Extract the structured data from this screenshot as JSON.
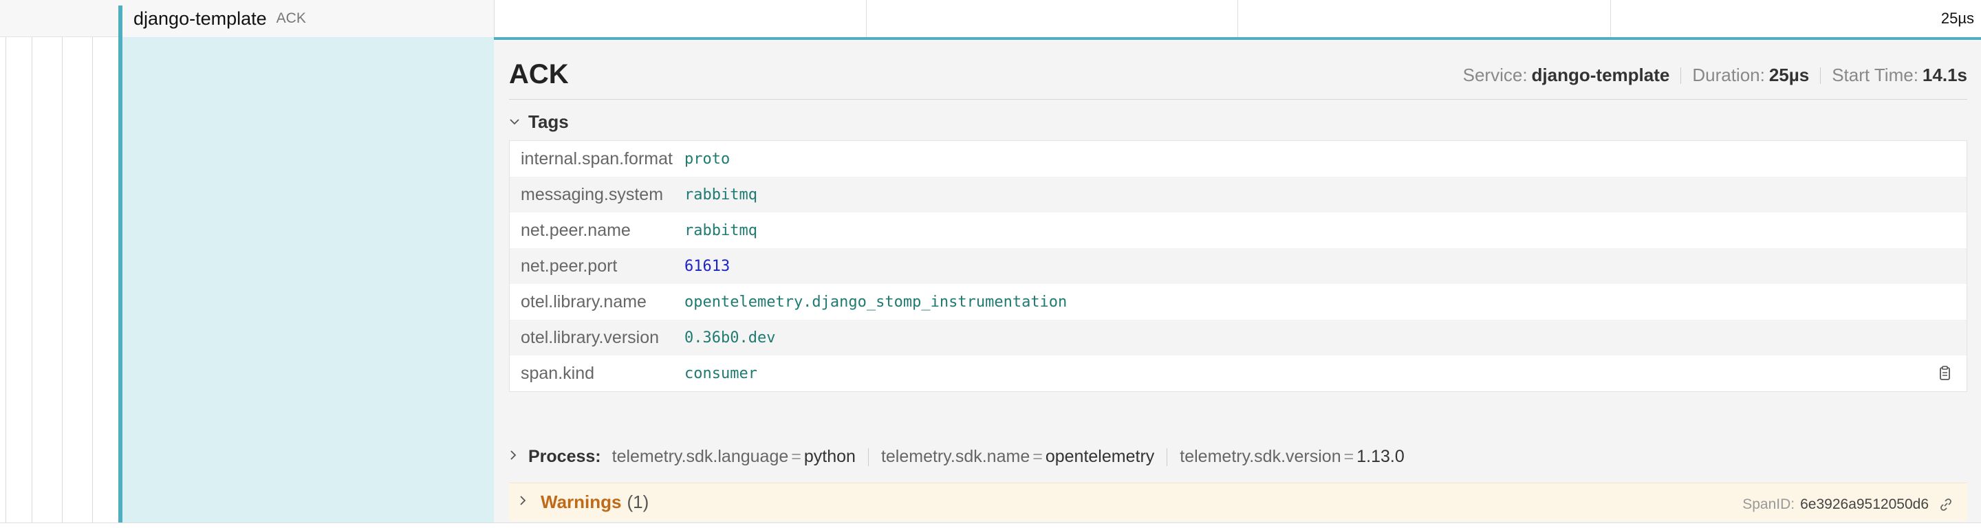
{
  "row": {
    "service": "django-template",
    "operation": "ACK",
    "duration": "25µs"
  },
  "detail": {
    "title": "ACK",
    "meta": [
      {
        "label": "Service:",
        "value": "django-template"
      },
      {
        "label": "Duration:",
        "value": "25µs"
      },
      {
        "label": "Start Time:",
        "value": "14.1s"
      }
    ],
    "tags_label": "Tags",
    "tags": [
      {
        "key": "internal.span.format",
        "value": "proto"
      },
      {
        "key": "messaging.system",
        "value": "rabbitmq"
      },
      {
        "key": "net.peer.name",
        "value": "rabbitmq"
      },
      {
        "key": "net.peer.port",
        "value": "61613"
      },
      {
        "key": "otel.library.name",
        "value": "opentelemetry.django_stomp_instrumentation"
      },
      {
        "key": "otel.library.version",
        "value": "0.36b0.dev"
      },
      {
        "key": "span.kind",
        "value": "consumer"
      }
    ],
    "process_label": "Process:",
    "process": [
      {
        "key": "telemetry.sdk.language",
        "value": "python"
      },
      {
        "key": "telemetry.sdk.name",
        "value": "opentelemetry"
      },
      {
        "key": "telemetry.sdk.version",
        "value": "1.13.0"
      }
    ],
    "warnings_label": "Warnings",
    "warnings_count": "(1)",
    "span_id_label": "SpanID:",
    "span_id": "6e3926a9512050d6"
  },
  "colors": {
    "accent": "#4fafc0",
    "span_bg": "#daf0f3",
    "warning": "#c06a17",
    "tag_value": "#1f7a72",
    "tag_number": "#1a24c8"
  },
  "icons": [
    "chevron-down-icon",
    "chevron-right-icon",
    "copy-icon",
    "link-icon"
  ]
}
